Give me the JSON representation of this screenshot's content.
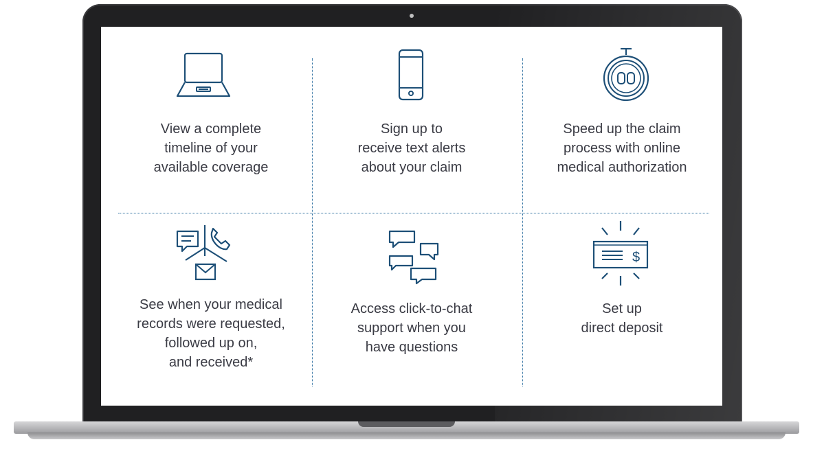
{
  "features": [
    {
      "label": "View a complete\ntimeline of your\navailable coverage",
      "icon": "laptop-icon"
    },
    {
      "label": "Sign up to\nreceive text alerts\nabout your claim",
      "icon": "mobile-phone-icon"
    },
    {
      "label": "Speed up the claim\nprocess with online\nmedical authorization",
      "icon": "stopwatch-icon"
    },
    {
      "label": "See when your medical\nrecords were requested,\nfollowed up on,\nand received*",
      "icon": "communication-icon"
    },
    {
      "label": "Access click-to-chat\nsupport when you\nhave questions",
      "icon": "chat-bubbles-icon"
    },
    {
      "label": "Set up\ndirect deposit",
      "icon": "check-deposit-icon"
    }
  ],
  "colors": {
    "icon_stroke": "#1d4f77",
    "text": "#3a3b44",
    "divider": "#2d6fa0"
  }
}
